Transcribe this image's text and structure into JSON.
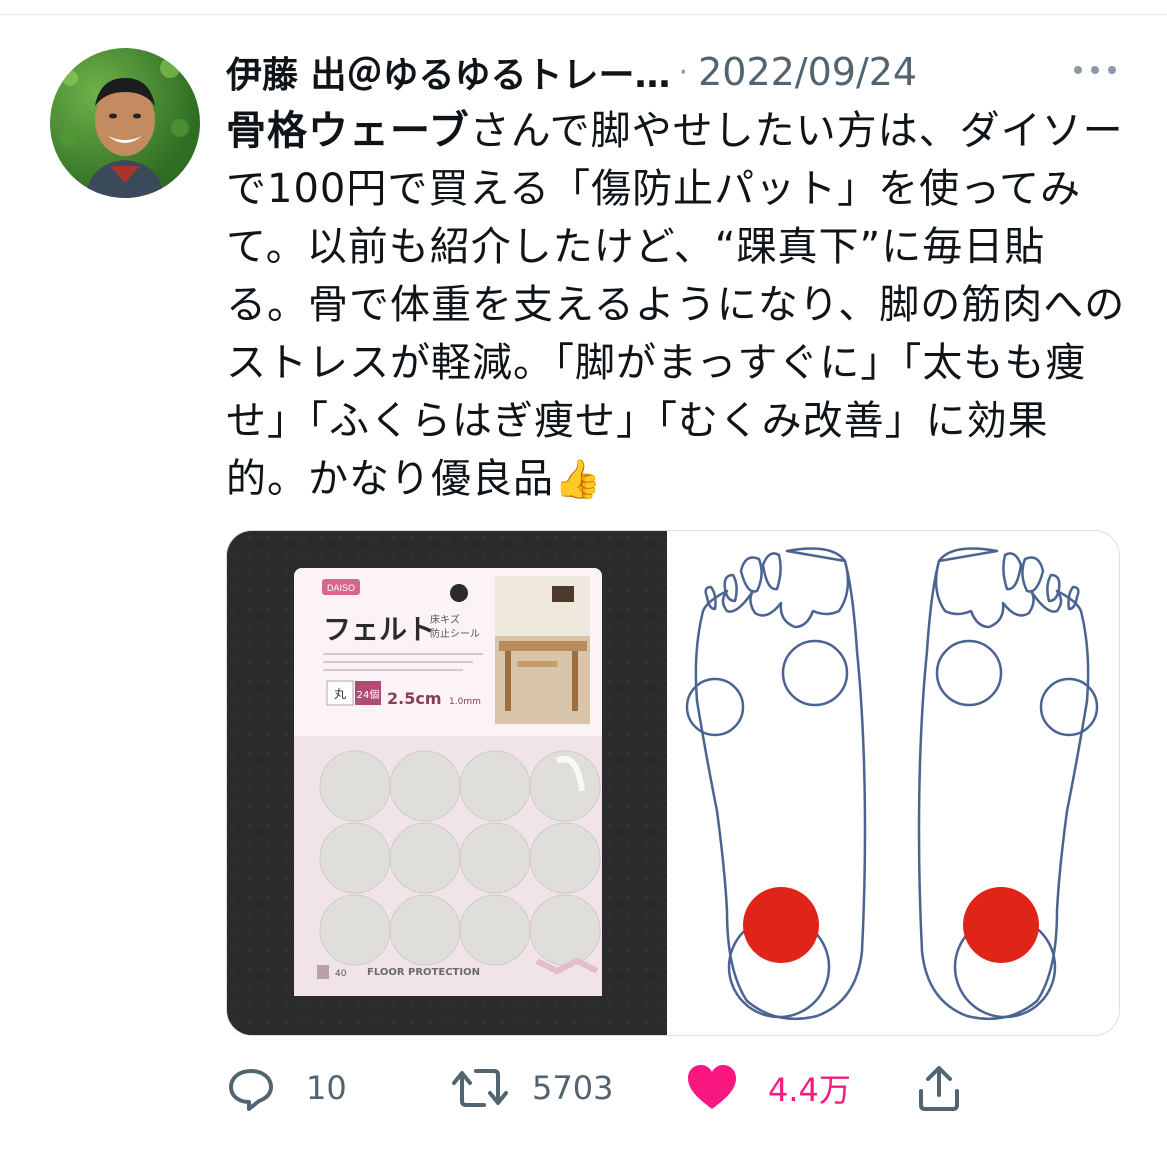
{
  "tweet": {
    "author": "伊藤 出＠ゆるゆるトレー…",
    "separator": "·",
    "date": "2022/09/24",
    "body_bold": "骨格ウェーブ",
    "body_text": "さんで脚やせしたい方は、ダイソーで100円で買える「傷防止パット」を使ってみて。以前も紹介したけど、“踝真下”に毎日貼る。骨で体重を支えるようになり、脚の筋肉へのストレスが軽減。「脚がまっすぐに」「太もも痩せ」「ふくらはぎ痩せ」「むくみ改善」に効果的。かなり優良品",
    "emoji": "👍"
  },
  "media": {
    "package": {
      "brand": "DAISO",
      "title": "フェルト",
      "subtitle_line1": "床キズ",
      "subtitle_line2": "防止シール",
      "shape": "丸",
      "count": "24個",
      "size": "2.5cm",
      "thickness": "1.0mm",
      "bottom_text": "FLOOR PROTECTION",
      "price_badge": "40"
    }
  },
  "actions": {
    "reply_count": "10",
    "retweet_count": "5703",
    "like_count": "4.4万"
  },
  "colors": {
    "like": "#f91880",
    "muted": "#536471",
    "foot_outline": "#3f5a8a",
    "dot_red": "#e02418"
  }
}
